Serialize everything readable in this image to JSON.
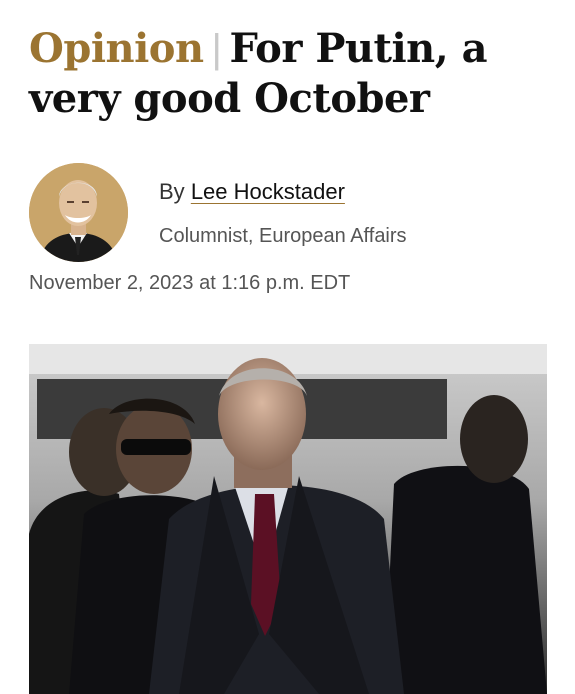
{
  "article": {
    "kicker": "Opinion",
    "separator": "|",
    "title": "For Putin, a very good October",
    "byline_prefix": "By",
    "author": "Lee Hockstader",
    "author_role": "Columnist, European Affairs",
    "timestamp": "November 2, 2023 at 1:16 p.m. EDT"
  },
  "colors": {
    "kicker": "#9b7431",
    "avatar_bg": "#c9a56a"
  }
}
